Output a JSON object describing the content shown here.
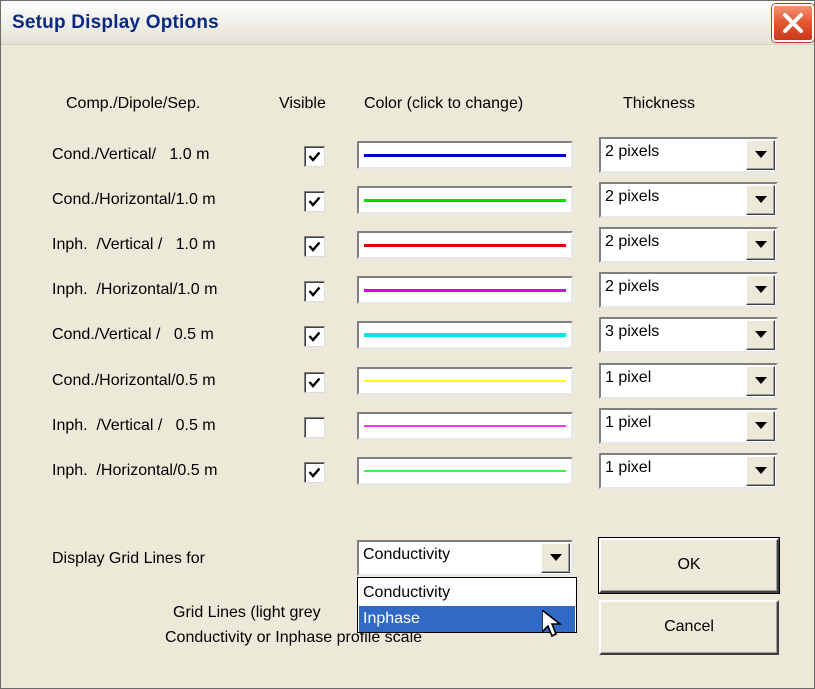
{
  "window": {
    "title": "Setup Display Options"
  },
  "headers": {
    "comp": "Comp./Dipole/Sep.",
    "visible": "Visible",
    "color": "Color (click to change)",
    "thickness": "Thickness"
  },
  "rows": [
    {
      "label": "Cond./Vertical/   1.0 m",
      "visible": true,
      "color": "#0000cc",
      "thickness": "2 pixels"
    },
    {
      "label": "Cond./Horizontal/1.0 m",
      "visible": true,
      "color": "#00dd00",
      "thickness": "2 pixels"
    },
    {
      "label": "Inph.  /Vertical /   1.0 m",
      "visible": true,
      "color": "#dd0000",
      "thickness": "2 pixels"
    },
    {
      "label": "Inph.  /Horizontal/1.0 m",
      "visible": true,
      "color": "#dd00dd",
      "thickness": "2 pixels"
    },
    {
      "label": "Cond./Vertical /   0.5 m",
      "visible": true,
      "color": "#00e5e5",
      "thickness": "3 pixels"
    },
    {
      "label": "Cond./Horizontal/0.5 m",
      "visible": true,
      "color": "#ffff00",
      "thickness": "1 pixel"
    },
    {
      "label": "Inph.  /Vertical /   0.5 m",
      "visible": false,
      "color": "#ff33ff",
      "thickness": "1 pixel"
    },
    {
      "label": "Inph.  /Horizontal/0.5 m",
      "visible": true,
      "color": "#33ff33",
      "thickness": "1 pixel"
    }
  ],
  "grid": {
    "label": "Display Grid Lines for",
    "selected": "Conductivity",
    "options": [
      "Conductivity",
      "Inphase"
    ],
    "highlighted": "Inphase",
    "note_line1": "Grid Lines (light grey",
    "note_line2": "Conductivity or Inphase profile scale"
  },
  "buttons": {
    "ok": "OK",
    "cancel": "Cancel"
  },
  "colors": {
    "titlebar_text": "#0b2a86",
    "selection": "#316ac5",
    "face": "#ece9d8"
  }
}
